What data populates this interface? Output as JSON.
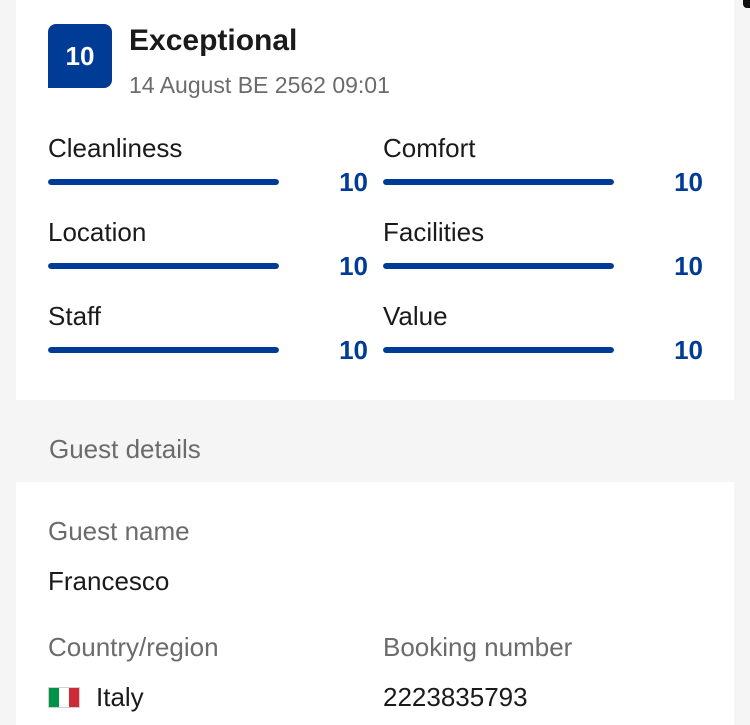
{
  "review": {
    "score": "10",
    "title": "Exceptional",
    "date": "14 August BE 2562 09:01"
  },
  "ratings": [
    {
      "label": "Cleanliness",
      "value": "10",
      "fraction": 1.0
    },
    {
      "label": "Comfort",
      "value": "10",
      "fraction": 1.0
    },
    {
      "label": "Location",
      "value": "10",
      "fraction": 1.0
    },
    {
      "label": "Facilities",
      "value": "10",
      "fraction": 1.0
    },
    {
      "label": "Staff",
      "value": "10",
      "fraction": 1.0
    },
    {
      "label": "Value",
      "value": "10",
      "fraction": 1.0
    }
  ],
  "guest_details": {
    "section_label": "Guest details",
    "guest_name_label": "Guest name",
    "guest_name": "Francesco",
    "country_label": "Country/region",
    "country": "Italy",
    "country_flag_icon": "italy-flag-icon",
    "country_flag_colors": [
      "#009246",
      "#ffffff",
      "#ce2b37"
    ],
    "booking_label": "Booking number",
    "booking_number": "2223835793"
  },
  "colors": {
    "accent": "#003b95",
    "background": "#f5f5f5",
    "card": "#ffffff",
    "muted_text": "#6b6b6b"
  }
}
